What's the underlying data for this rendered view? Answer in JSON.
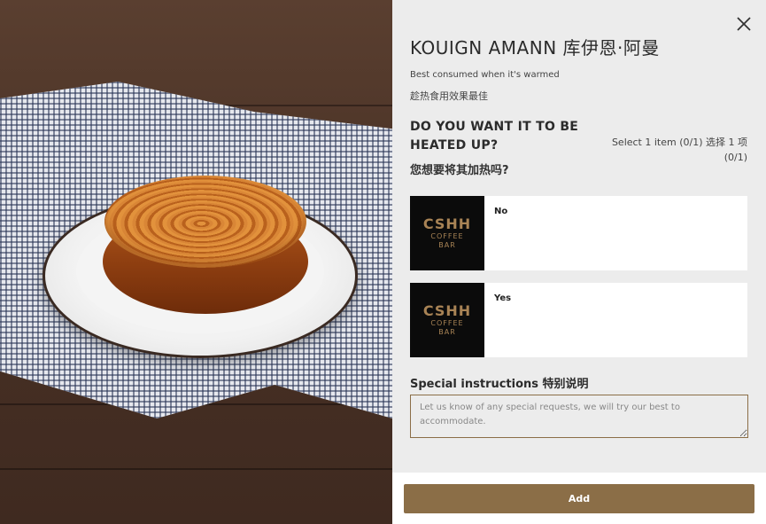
{
  "product": {
    "title": "KOUIGN AMANN 库伊恩·阿曼",
    "subtitle_en": "Best consumed when it's warmed",
    "subtitle_zh": "趁热食用效果最佳"
  },
  "question": {
    "title_en": "DO YOU WANT IT TO BE HEATED UP?",
    "title_zh": "您想要将其加热吗?",
    "hint": "Select 1 item (0/1) 选择 1 项 (0/1)"
  },
  "options": [
    {
      "label": "No",
      "logo_main": "CSHH",
      "logo_line1": "COFFEE",
      "logo_line2": "BAR"
    },
    {
      "label": "Yes",
      "logo_main": "CSHH",
      "logo_line1": "COFFEE",
      "logo_line2": "BAR"
    }
  ],
  "special_instructions": {
    "label": "Special instructions 特别说明",
    "placeholder": "Let us know of any special requests, we will try our best to accommodate."
  },
  "footer": {
    "add_label": "Add"
  },
  "colors": {
    "accent": "#8b6e47",
    "panel_bg": "#ececec",
    "logo_gold": "#a88355"
  },
  "icons": {
    "close": "close-icon"
  }
}
